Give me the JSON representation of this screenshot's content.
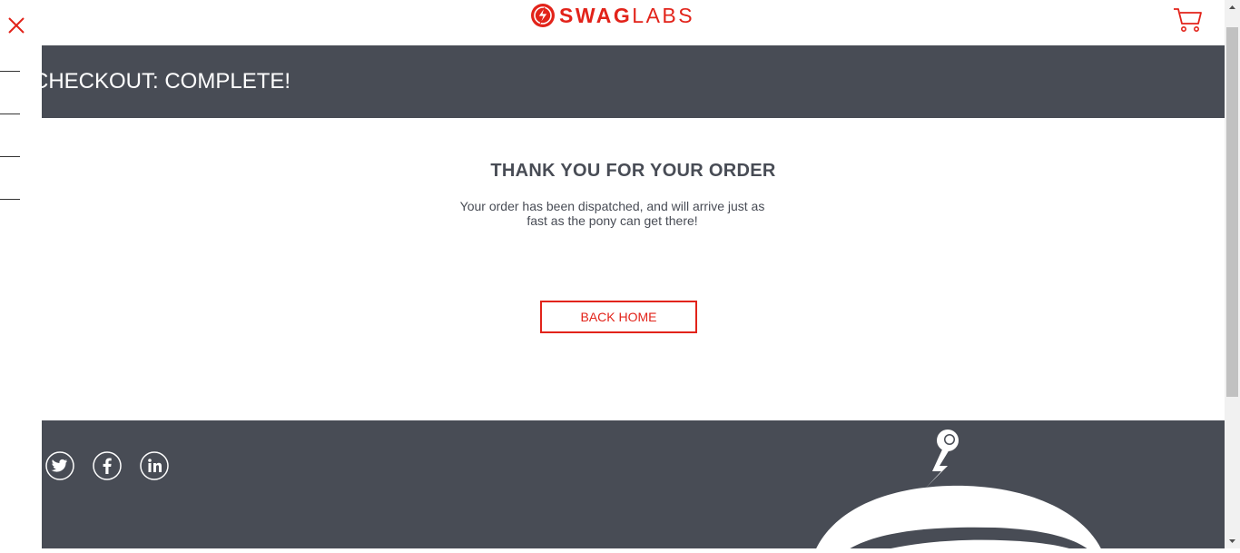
{
  "header": {
    "logo_swag": "SWAG",
    "logo_labs": "LABS"
  },
  "page": {
    "title": "CHECKOUT: COMPLETE!"
  },
  "complete": {
    "header": "THANK YOU FOR YOUR ORDER",
    "text": "Your order has been dispatched, and will arrive just as fast as the pony can get there!",
    "button_label": "BACK HOME"
  },
  "footer": {
    "social": [
      "twitter-icon",
      "facebook-icon",
      "linkedin-icon"
    ]
  },
  "colors": {
    "accent": "#e2231a",
    "band": "#484c55"
  }
}
